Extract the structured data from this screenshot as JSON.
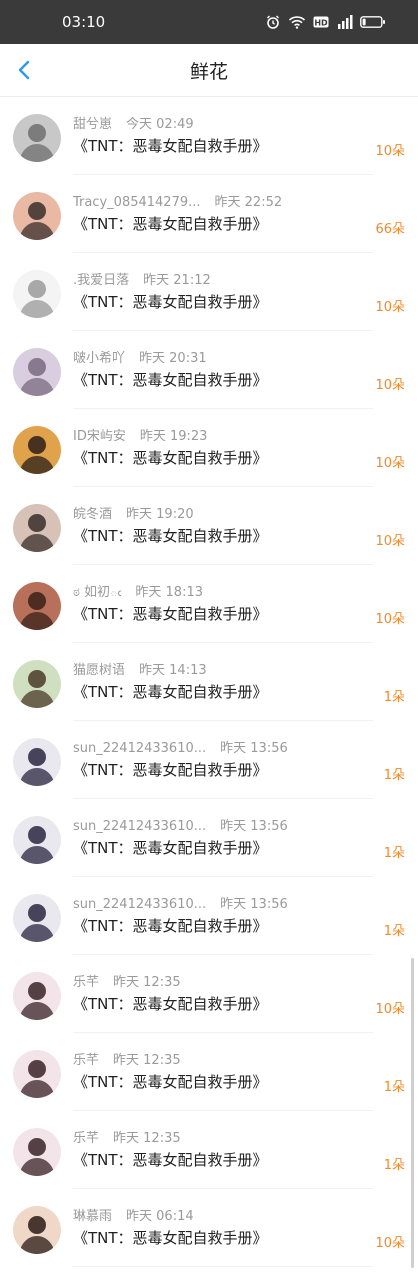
{
  "status": {
    "time": "03:10"
  },
  "header": {
    "title": "鲜花"
  },
  "colors": {
    "accent": "#f08a2c",
    "status_bar": "#3a3a3a"
  },
  "items": [
    {
      "name": "甜兮崽",
      "time": "今天 02:49",
      "book": "《TNT：恶毒女配自救手册》",
      "count": "10朵",
      "avatar": [
        "#c8c8c8",
        "#6e6e6e"
      ]
    },
    {
      "name": "Tracy_085414279...",
      "time": "昨天 22:52",
      "book": "《TNT：恶毒女配自救手册》",
      "count": "66朵",
      "avatar": [
        "#e9b9a4",
        "#3a2e2c"
      ]
    },
    {
      "name": ".我爱日落",
      "time": "昨天 21:12",
      "book": "《TNT：恶毒女配自救手册》",
      "count": "10朵",
      "avatar": [
        "#f4f4f4",
        "#9a9a9a"
      ]
    },
    {
      "name": "啵小希吖",
      "time": "昨天 20:31",
      "book": "《TNT：恶毒女配自救手册》",
      "count": "10朵",
      "avatar": [
        "#d9cde0",
        "#7a6a80"
      ]
    },
    {
      "name": "ID宋屿安",
      "time": "昨天 19:23",
      "book": "《TNT：恶毒女配自救手册》",
      "count": "10朵",
      "avatar": [
        "#e0a24a",
        "#2a1e18"
      ]
    },
    {
      "name": "皖冬酒",
      "time": "昨天 19:20",
      "book": "《TNT：恶毒女配自救手册》",
      "count": "10朵",
      "avatar": [
        "#d8c2b8",
        "#3a2e2a"
      ]
    },
    {
      "name": "ಠ 如初ఁ",
      "time": "昨天 18:13",
      "book": "《TNT：恶毒女配自救手册》",
      "count": "10朵",
      "avatar": [
        "#b8705a",
        "#3a2018"
      ]
    },
    {
      "name": "猫愿树语",
      "time": "昨天 14:13",
      "book": "《TNT：恶毒女配自救手册》",
      "count": "1朵",
      "avatar": [
        "#cfe0c0",
        "#4a3a28"
      ]
    },
    {
      "name": "sun_22412433610...",
      "time": "昨天 13:56",
      "book": "《TNT：恶毒女配自救手册》",
      "count": "1朵",
      "avatar": [
        "#e8e8ee",
        "#2a2640"
      ]
    },
    {
      "name": "sun_22412433610...",
      "time": "昨天 13:56",
      "book": "《TNT：恶毒女配自救手册》",
      "count": "1朵",
      "avatar": [
        "#e8e8ee",
        "#2a2640"
      ]
    },
    {
      "name": "sun_22412433610...",
      "time": "昨天 13:56",
      "book": "《TNT：恶毒女配自救手册》",
      "count": "1朵",
      "avatar": [
        "#e8e8ee",
        "#2a2640"
      ]
    },
    {
      "name": "乐芊",
      "time": "昨天 12:35",
      "book": "《TNT：恶毒女配自救手册》",
      "count": "10朵",
      "avatar": [
        "#f2e4e8",
        "#3a2428"
      ]
    },
    {
      "name": "乐芊",
      "time": "昨天 12:35",
      "book": "《TNT：恶毒女配自救手册》",
      "count": "1朵",
      "avatar": [
        "#f2e4e8",
        "#3a2428"
      ]
    },
    {
      "name": "乐芊",
      "time": "昨天 12:35",
      "book": "《TNT：恶毒女配自救手册》",
      "count": "1朵",
      "avatar": [
        "#f2e4e8",
        "#3a2428"
      ]
    },
    {
      "name": "琳慕雨",
      "time": "昨天 06:14",
      "book": "《TNT：恶毒女配自救手册》",
      "count": "10朵",
      "avatar": [
        "#f0d8c8",
        "#2a1a14"
      ]
    }
  ]
}
